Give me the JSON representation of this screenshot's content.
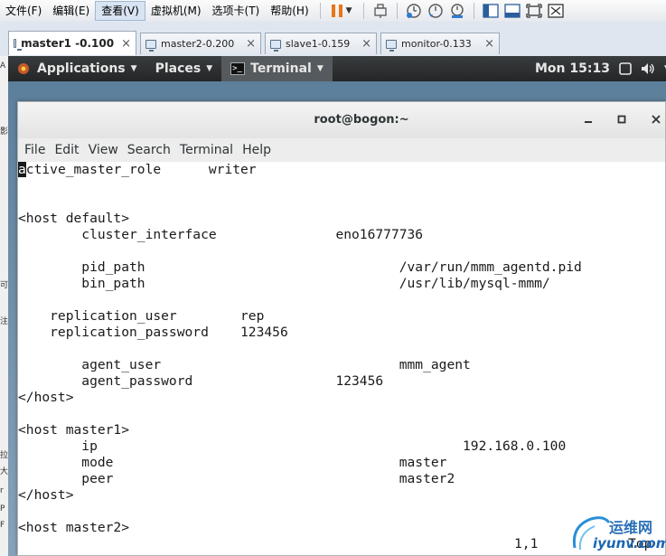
{
  "host": {
    "menus": [
      {
        "label": "文件(F)",
        "active": false
      },
      {
        "label": "编辑(E)",
        "active": false
      },
      {
        "label": "查看(V)",
        "active": true
      },
      {
        "label": "虚拟机(M)",
        "active": false
      },
      {
        "label": "选项卡(T)",
        "active": false
      },
      {
        "label": "帮助(H)",
        "active": false
      }
    ],
    "toolbar_icons": [
      "pause-icon",
      "send-keys-icon",
      "snapshot-icon",
      "revert-snapshot-icon",
      "snapshot-manager-icon",
      "show-library-icon",
      "thumbnail-icon",
      "fullscreen-icon",
      "unity-icon"
    ],
    "colors": {
      "pause": "#e8761a",
      "snapshot": "#2e7bd1"
    }
  },
  "vm_tabs": [
    {
      "label": "master1 -0.100",
      "active": true,
      "close": "×"
    },
    {
      "label": "master2-0.200",
      "active": false,
      "close": "×"
    },
    {
      "label": "slave1-0.159",
      "active": false,
      "close": "×"
    },
    {
      "label": "monitor-0.133",
      "active": false,
      "close": "×"
    }
  ],
  "left_strip_glyphs": [
    "A",
    "影",
    "可",
    "注",
    "拉",
    "大",
    "r",
    "P",
    "F"
  ],
  "gnome": {
    "applications": "Applications",
    "places": "Places",
    "terminal": "Terminal",
    "clock": "Mon 15:13"
  },
  "terminal": {
    "title": "root@bogon:~",
    "menus": [
      "File",
      "Edit",
      "View",
      "Search",
      "Terminal",
      "Help"
    ],
    "cursor_char": "a",
    "lines": [
      {
        "row": 0,
        "text": "ctive_master_role      writer"
      },
      {
        "row": 3,
        "text": "<host default>"
      },
      {
        "row": 4,
        "text": "        cluster_interface               eno16777736"
      },
      {
        "row": 6,
        "text": "        pid_path                                /var/run/mmm_agentd.pid"
      },
      {
        "row": 7,
        "text": "        bin_path                                /usr/lib/mysql-mmm/"
      },
      {
        "row": 9,
        "text": "    replication_user        rep"
      },
      {
        "row": 10,
        "text": "    replication_password    123456"
      },
      {
        "row": 12,
        "text": "        agent_user                              mmm_agent"
      },
      {
        "row": 13,
        "text": "        agent_password                  123456"
      },
      {
        "row": 14,
        "text": "</host>"
      },
      {
        "row": 16,
        "text": "<host master1>"
      },
      {
        "row": 17,
        "text": "        ip                                              192.168.0.100"
      },
      {
        "row": 18,
        "text": "        mode                                    master"
      },
      {
        "row": 19,
        "text": "        peer                                    master2"
      },
      {
        "row": 20,
        "text": "</host>"
      },
      {
        "row": 22,
        "text": "<host master2>"
      }
    ],
    "status_position": "1,1",
    "status_scroll": "Top"
  },
  "watermark": {
    "cn": "运维网",
    "en": "iyunv.com"
  }
}
